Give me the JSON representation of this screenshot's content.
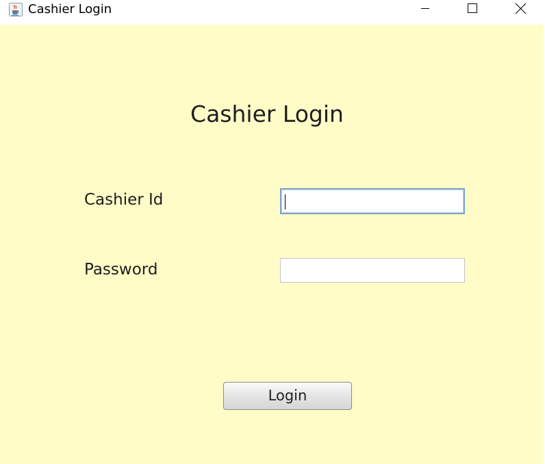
{
  "window": {
    "title": "Cashier Login",
    "app_icon": "java-coffee-icon",
    "controls": {
      "minimize": "minimize-icon",
      "maximize": "maximize-icon",
      "close": "close-icon"
    }
  },
  "form": {
    "heading": "Cashier Login",
    "cashier_id_label": "Cashier Id",
    "cashier_id_value": "",
    "password_label": "Password",
    "password_value": "",
    "login_label": "Login"
  },
  "colors": {
    "background": "#fffcc8",
    "focus_border": "#7aa3c6"
  }
}
